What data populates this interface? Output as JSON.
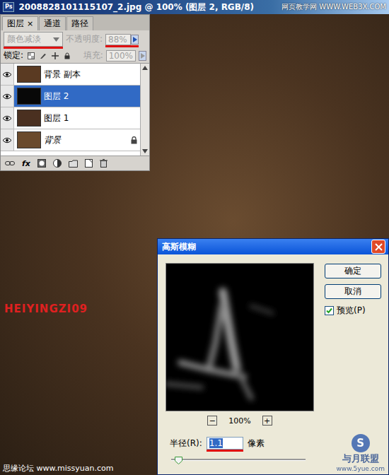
{
  "window": {
    "app_icon": "Ps",
    "title": "2008828101115107_2.jpg @ 100% (图层 2, RGB/8)",
    "watermark": "网页教学网 WWW.WEB3X.COM"
  },
  "layers_panel": {
    "tabs": [
      {
        "label": "图层",
        "close": "×",
        "selected": true
      },
      {
        "label": "通道",
        "close": "",
        "selected": false
      },
      {
        "label": "路径",
        "close": "",
        "selected": false
      }
    ],
    "blend_mode": {
      "value": "颜色减淡",
      "disabled": true,
      "marked": true
    },
    "opacity": {
      "label": "不透明度:",
      "value": "88%",
      "disabled": true,
      "marked": true
    },
    "lock_label": "锁定:",
    "fill": {
      "label": "填充:",
      "value": "100%",
      "disabled": true
    },
    "layers": [
      {
        "name": "背景 副本",
        "visible": true,
        "selected": false,
        "locked": false,
        "italic": false,
        "color": "#5a3a22"
      },
      {
        "name": "图层 2",
        "visible": true,
        "selected": true,
        "locked": false,
        "italic": false,
        "color": "#080808"
      },
      {
        "name": "图层 1",
        "visible": true,
        "selected": false,
        "locked": false,
        "italic": false,
        "color": "#4a3020"
      },
      {
        "name": "背景",
        "visible": true,
        "selected": false,
        "locked": true,
        "italic": true,
        "color": "#6a4a2c"
      }
    ],
    "toolbar_fx": "fx"
  },
  "signature": "HEIYINGZI09",
  "dialog": {
    "title": "高斯模糊",
    "buttons": [
      "确定",
      "取消"
    ],
    "preview": {
      "label": "预览(P)",
      "checked": true
    },
    "zoom": {
      "out": "−",
      "level": "100%",
      "in": "+"
    },
    "radius": {
      "label": "半径(R):",
      "value": "1.1",
      "selected": true,
      "marked": true,
      "unit": "像素",
      "level": 0.05
    }
  },
  "footer": {
    "forum": "思缘论坛 www.missyuan.com",
    "logo_badge": "S",
    "logo_text": "与月联盟",
    "logo_url": "www.5yue.com"
  }
}
